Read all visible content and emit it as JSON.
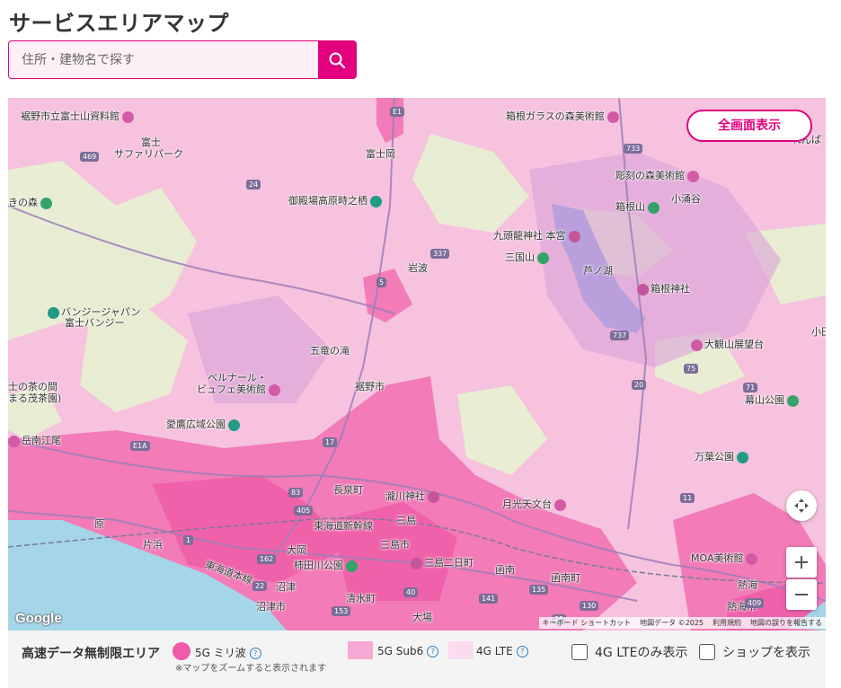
{
  "page": {
    "title": "サービスエリアマップ"
  },
  "search": {
    "placeholder": "住所・建物名で探す"
  },
  "map": {
    "fullscreen_label": "全画面表示",
    "google_logo": "Google",
    "attribution": [
      "キーボード ショートカット",
      "地図データ ©2025",
      "利用規約",
      "地図の誤りを報告する"
    ],
    "places": [
      {
        "name": "裾野市立富士山資料館",
        "type": "museum"
      },
      {
        "name": "富士",
        "type": "text"
      },
      {
        "name": "サファリパーク",
        "type": "text"
      },
      {
        "name": "富士岡",
        "type": "text"
      },
      {
        "name": "御殿場高原時之栖",
        "type": "attraction"
      },
      {
        "name": "岩波",
        "type": "text"
      },
      {
        "name": "バンジージャパン",
        "type": "attraction"
      },
      {
        "name": "富士バンジー",
        "type": "text"
      },
      {
        "name": "五竜の滝",
        "type": "text"
      },
      {
        "name": "ベルナール・",
        "type": "text"
      },
      {
        "name": "ビュフェ美術館",
        "type": "museum"
      },
      {
        "name": "裾野市",
        "type": "text"
      },
      {
        "name": "愛鷹広域公園",
        "type": "attraction"
      },
      {
        "name": "長泉町",
        "type": "text"
      },
      {
        "name": "瀧川神社",
        "type": "temple"
      },
      {
        "name": "三島",
        "type": "text"
      },
      {
        "name": "大岡",
        "type": "text"
      },
      {
        "name": "三島市",
        "type": "text"
      },
      {
        "name": "柿田川公園",
        "type": "park"
      },
      {
        "name": "三島二日町",
        "type": "text"
      },
      {
        "name": "沼津",
        "type": "text"
      },
      {
        "name": "沼津市",
        "type": "text"
      },
      {
        "name": "清水町",
        "type": "text"
      },
      {
        "name": "大場",
        "type": "text"
      },
      {
        "name": "片浜",
        "type": "text"
      },
      {
        "name": "原",
        "type": "text"
      },
      {
        "name": "函南",
        "type": "text"
      },
      {
        "name": "函南町",
        "type": "text"
      },
      {
        "name": "月光天文台",
        "type": "text"
      },
      {
        "name": "箱根ガラスの森美術館",
        "type": "museum"
      },
      {
        "name": "彫刻の森美術館",
        "type": "museum"
      },
      {
        "name": "小涌谷",
        "type": "text"
      },
      {
        "name": "箱根山",
        "type": "park"
      },
      {
        "name": "九頭龍神社 本宮",
        "type": "temple"
      },
      {
        "name": "三国山",
        "type": "park"
      },
      {
        "name": "芦ノ湖",
        "type": "text"
      },
      {
        "name": "箱根神社",
        "type": "temple"
      },
      {
        "name": "大観山展望台",
        "type": "museum"
      },
      {
        "name": "幕山公園",
        "type": "park"
      },
      {
        "name": "万葉公園",
        "type": "attraction"
      },
      {
        "name": "MOA美術館",
        "type": "museum"
      },
      {
        "name": "熱海",
        "type": "text"
      },
      {
        "name": "熱海市",
        "type": "text"
      },
      {
        "name": "きの森",
        "type": "park"
      },
      {
        "name": "士の茶の間",
        "type": "text"
      },
      {
        "name": "まる茂茶園)",
        "type": "text"
      },
      {
        "name": "岳南江尾",
        "type": "text"
      },
      {
        "name": "東海道新幹線",
        "type": "text"
      },
      {
        "name": "東海道本線",
        "type": "text"
      },
      {
        "name": "小田",
        "type": "text"
      },
      {
        "name": "れんば",
        "type": "text"
      }
    ],
    "routes": [
      "469",
      "24",
      "733",
      "337",
      "E1",
      "5",
      "737",
      "75",
      "20",
      "71",
      "E1A",
      "83",
      "405",
      "1",
      "162",
      "22",
      "141",
      "135",
      "11",
      "409",
      "153",
      "130",
      "40",
      "25",
      "17"
    ]
  },
  "legend": {
    "title": "高速データ無制限エリア",
    "items": [
      {
        "label": "5G ミリ波",
        "color": "#f05aa8"
      },
      {
        "label": "5G Sub6",
        "color": "#f7a8d4"
      },
      {
        "label": "4G LTE",
        "color": "#fbdcee"
      }
    ],
    "note": "※マップをズームすると表示されます",
    "help": "?",
    "checkboxes": [
      {
        "label": "4G LTEのみ表示",
        "checked": false
      },
      {
        "label": "ショップを表示",
        "checked": false
      }
    ]
  }
}
